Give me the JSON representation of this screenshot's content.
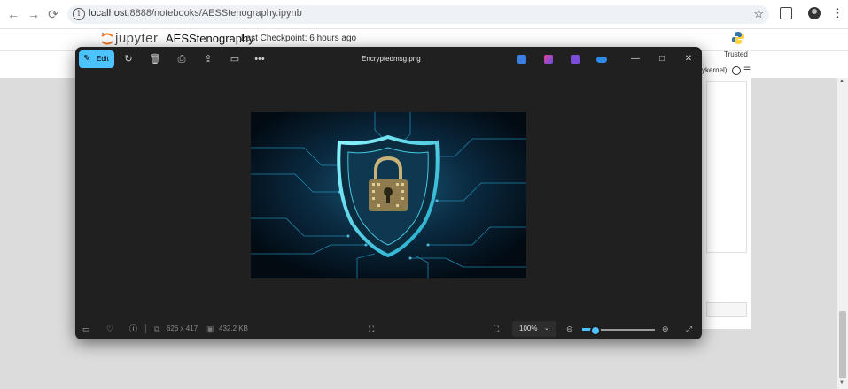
{
  "browser": {
    "url_host": "localhost",
    "url_rest": ":8888/notebooks/AESStenography.ipynb",
    "icons": [
      "back-icon",
      "forward-icon",
      "reload-icon",
      "site-info-icon",
      "bookmark-star-icon",
      "extensions-icon",
      "profile-icon",
      "menu-icon"
    ]
  },
  "jupyter": {
    "logo_text": "jupyter",
    "notebook_name": "AESStenography",
    "checkpoint": "Last Checkpoint: 6 hours ago",
    "trusted": "Trusted",
    "kernel": "ykernel)"
  },
  "viewer": {
    "edit_label": "Edit",
    "title": "Encryptedmsg.png",
    "dimensions": "626 x 417",
    "file_size": "432.2 KB",
    "zoom": "100%",
    "zoom_fraction": 0.17,
    "accent": "#4cc2ff",
    "image_description_icon": "shield-lock-circuit-image"
  }
}
